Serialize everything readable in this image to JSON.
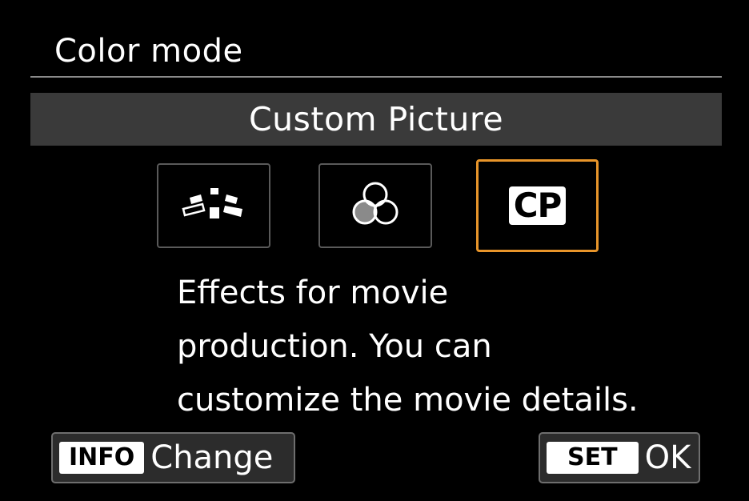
{
  "header": {
    "title": "Color mode"
  },
  "mode": {
    "selected_label": "Custom Picture"
  },
  "options": [
    {
      "name": "wide-dr-icon",
      "selected": false
    },
    {
      "name": "color-filter-icon",
      "selected": false
    },
    {
      "name": "custom-picture-icon",
      "label": "CP",
      "selected": true
    }
  ],
  "description": {
    "lines": [
      "Effects for movie",
      "production. You can",
      "customize the movie details."
    ]
  },
  "softkeys": {
    "info_key": "INFO",
    "info_action": "Change",
    "set_key": "SET",
    "set_action": "OK"
  },
  "colors": {
    "accent": "#e8952a",
    "background": "#000000",
    "bar": "#3a3a3a"
  }
}
